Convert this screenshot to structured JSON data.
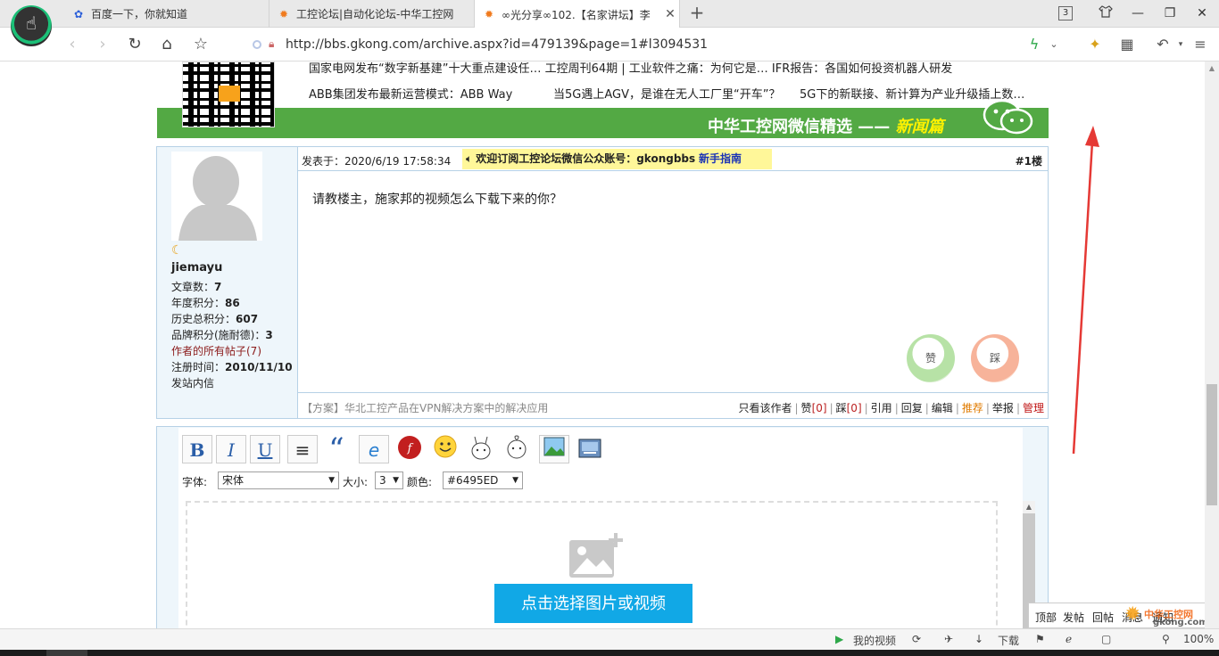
{
  "browser": {
    "tabs": [
      {
        "label": "百度一下，你就知道",
        "icon": "baidu-paw-icon"
      },
      {
        "label": "工控论坛|自动化论坛-中华工控网",
        "icon": "gkong-gear-icon"
      },
      {
        "label": "∞光分享∞102.【名家讲坛】李",
        "icon": "gkong-gear-icon",
        "active": true
      }
    ],
    "tab_count": "3",
    "address": "http://bbs.gkong.com/archive.aspx?id=479139&page=1#l3094531"
  },
  "banner": {
    "news": [
      "国家电网发布“数字新基建”十大重点建设任… 工控周刊64期 | 工业软件之痛：为何它是… IFR报告：各国如何投资机器人研发",
      "ABB集团发布最新运营模式：ABB Way",
      "当5G遇上AGV，是谁在无人工厂里“开车”？",
      "5G下的新联接、新计算为产业升级插上数…"
    ],
    "title_main": "中华工控网微信精选 ——",
    "title_em": "新闻篇"
  },
  "user": {
    "name": "jiemayu",
    "stats": [
      {
        "label": "文章数：",
        "value": "7"
      },
      {
        "label": "年度积分：",
        "value": "86"
      },
      {
        "label": "历史总积分：",
        "value": "607"
      },
      {
        "label": "品牌积分(施耐德)：",
        "value": "3"
      }
    ],
    "all_posts": "作者的所有帖子(7)",
    "register_label": "注册时间：",
    "register_date": "2010/11/10",
    "message": "发站内信"
  },
  "post": {
    "posted_at": "发表于：2020/6/19 17:58:34",
    "notice": "欢迎订阅工控论坛微信公众账号：gkongbbs",
    "notice_guide": "新手指南",
    "floor": "#1楼",
    "body": "请教楼主，施家邦的视频怎么下载下来的你？",
    "vote_up": "赞",
    "vote_down": "踩",
    "footer_link": "【方案】华北工控产品在VPN解决方案中的解决应用",
    "actions": {
      "only_author": "只看该作者",
      "like": "赞",
      "like_count": "[0]",
      "dislike": "踩",
      "dislike_count": "[0]",
      "quote": "引用",
      "reply": "回复",
      "edit": "编辑",
      "recommend": "推荐",
      "report": "举报",
      "manage": "管理"
    }
  },
  "editor": {
    "font_label": "字体:",
    "font_value": "宋体",
    "size_label": "大小:",
    "size_value": "3",
    "color_label": "颜色:",
    "color_value": "#6495ED",
    "pick_media": "点击选择图片或视频"
  },
  "floatbar": {
    "top": "顶部",
    "post": "发帖",
    "reply": "回帖",
    "msg": "消息",
    "notice": "通知"
  },
  "watermark": {
    "cn": "中华工控网",
    "site": "gkong.com"
  },
  "status": {
    "my_video": "我的视频",
    "download": "下载",
    "zoom": "100%"
  },
  "colors": {
    "accent_green": "#53a944",
    "pick_button": "#11a8e6",
    "annotation": "#e53935"
  }
}
